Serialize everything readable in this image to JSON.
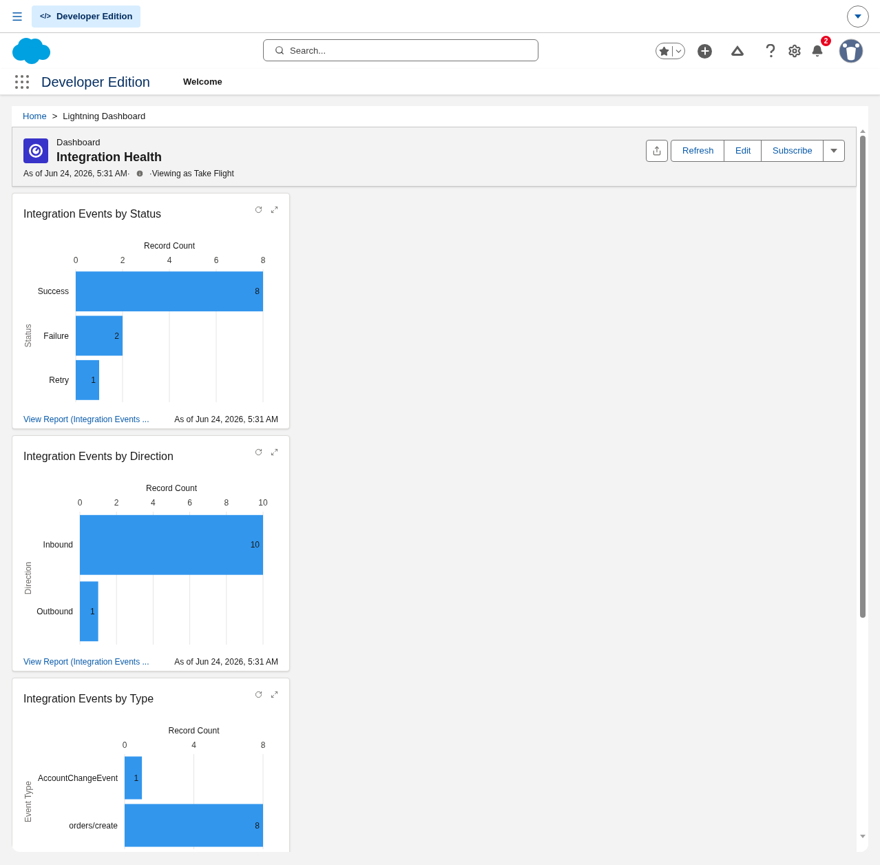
{
  "top_bar": {
    "badge_icon": "</>",
    "app_badge": "Developer Edition"
  },
  "search": {
    "placeholder": "Search..."
  },
  "notifications": {
    "count": "2"
  },
  "nav": {
    "app_name": "Developer Edition",
    "tabs": [
      {
        "label": "Welcome",
        "selected": false
      }
    ]
  },
  "breadcrumb": {
    "separator": ">",
    "items": [
      {
        "label": "Home",
        "link": true
      },
      {
        "label": "Lightning Dashboard",
        "link": false
      }
    ]
  },
  "dashboard": {
    "type_label": "Dashboard",
    "title": "Integration Health",
    "as_of": "As of Jun 24, 2026, 5:31 AM·",
    "viewing_as": "·Viewing as Take Flight",
    "buttons": [
      "Refresh",
      "Edit",
      "Subscribe"
    ]
  },
  "widgets": [
    {
      "title": "Integration Events by Status",
      "footer_link": "View Report (Integration Events ...",
      "footer_time": "As of Jun 24, 2026, 5:31 AM",
      "chart_data": {
        "type": "bar",
        "orientation": "horizontal",
        "grid": true,
        "xlabel": "Record Count",
        "ylabel": "Status",
        "categories": [
          "Success",
          "Failure",
          "Retry"
        ],
        "values": [
          8,
          2,
          1
        ],
        "xlim": [
          0,
          8
        ],
        "xticks": [
          0,
          2,
          4,
          6,
          8
        ],
        "data_labels": true
      }
    },
    {
      "title": "Integration Events by Direction",
      "footer_link": "View Report (Integration Events ...",
      "footer_time": "As of Jun 24, 2026, 5:31 AM",
      "chart_data": {
        "type": "bar",
        "orientation": "horizontal",
        "grid": true,
        "xlabel": "Record Count",
        "ylabel": "Direction",
        "categories": [
          "Inbound",
          "Outbound"
        ],
        "values": [
          10,
          1
        ],
        "xlim": [
          0,
          10
        ],
        "xticks": [
          0,
          2,
          4,
          6,
          8,
          10
        ],
        "data_labels": true
      }
    },
    {
      "title": "Integration Events by Type",
      "chart_data": {
        "type": "bar",
        "orientation": "horizontal",
        "grid": true,
        "xlabel": "Record Count",
        "ylabel": "Event Type",
        "categories": [
          "AccountChangeEvent",
          "orders/create"
        ],
        "values": [
          1,
          8
        ],
        "xlim": [
          0,
          8
        ],
        "xticks": [
          0,
          4,
          8
        ],
        "data_labels": true
      }
    }
  ]
}
